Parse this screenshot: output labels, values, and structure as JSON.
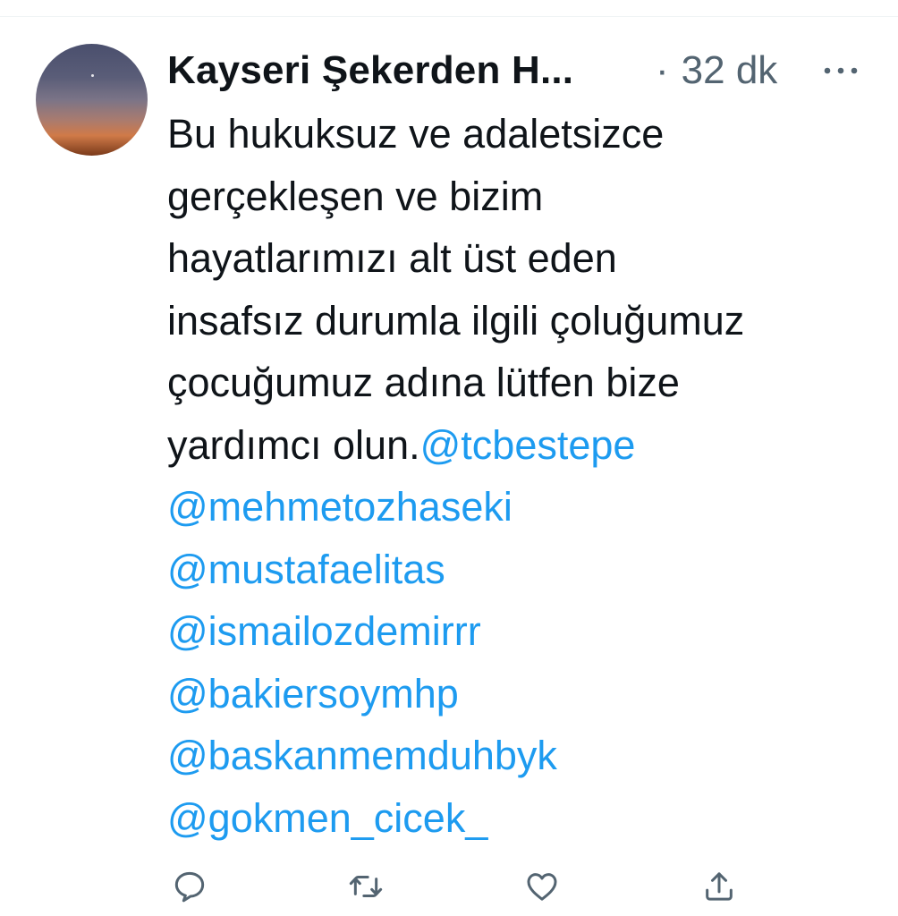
{
  "tweet": {
    "author": {
      "display_name": "Kayseri Şekerden H..."
    },
    "separator": "·",
    "time": "32 dk",
    "text_lines": [
      "Bu hukuksuz ve adaletsizce",
      "gerçekleşen ve bizim",
      "hayatlarımızı alt üst eden",
      "insafsız durumla ilgili çoluğumuz",
      "çocuğumuz adına lütfen bize"
    ],
    "last_text": "yardımcı olun.",
    "mentions": [
      "@tcbestepe",
      "@mehmetozhaseki",
      "@mustafaelitas",
      "@ismailozdemirrr",
      "@bakiersoymhp",
      "@baskanmemduhbyk",
      "@gokmen_cicek_"
    ]
  },
  "icons": {
    "more": "more-horizontal-icon",
    "reply": "reply-icon",
    "retweet": "retweet-icon",
    "like": "like-icon",
    "share": "share-icon"
  },
  "colors": {
    "text": "#0f1419",
    "secondary": "#536471",
    "link": "#1d9bf0",
    "divider": "#eff3f4"
  }
}
